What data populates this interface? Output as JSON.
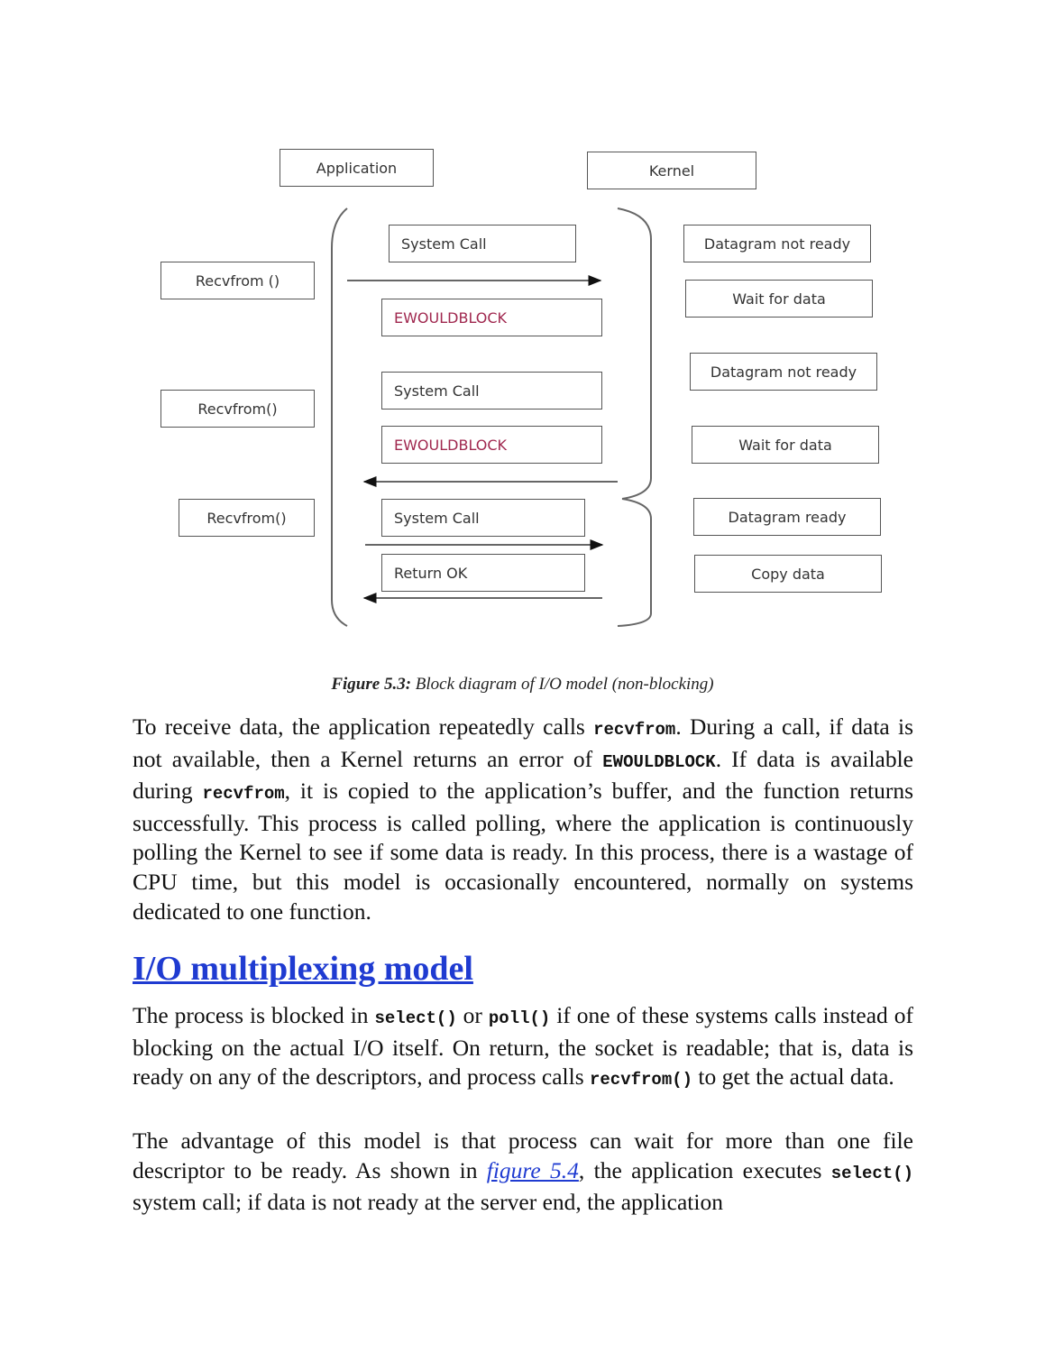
{
  "diagram": {
    "headers": {
      "application": "Application",
      "kernel": "Kernel"
    },
    "app_calls": [
      "Recvfrom ()",
      "Recvfrom()",
      "Recvfrom()"
    ],
    "middle_boxes": [
      "System Call",
      "EWOULDBLOCK",
      "System Call",
      "EWOULDBLOCK",
      "System Call",
      "Return OK"
    ],
    "kernel_boxes": [
      "Datagram not ready",
      "Wait for data",
      "Datagram not ready",
      "Wait for data",
      "Datagram ready",
      "Copy data"
    ],
    "colors": {
      "error_text": "#a0284f",
      "border": "#555555"
    }
  },
  "caption": {
    "label": "Figure 5.3:",
    "text": " Block diagram of I/O model (non-blocking)"
  },
  "para1": {
    "t1": "To receive data, the application repeatedly calls ",
    "c1": "recvfrom",
    "t2": ". During a call, if data is not available, then a Kernel returns an error of ",
    "c2": "EWOULDBLOCK",
    "t3": ". If data is available during ",
    "c3": "recvfrom",
    "t4": ", it is copied to the application’s buffer, and the function returns successfully. This process is called polling, where the application is continuously polling the Kernel to see if some data is ready. In this process, there is a wastage of CPU time, but this model is occasionally encountered, normally on systems dedicated to one function."
  },
  "section": {
    "heading": "I/O multiplexing model",
    "color": "#1f3bd1"
  },
  "para2": {
    "t1": "The process is blocked in ",
    "c1": "select()",
    "t2": " or ",
    "c2": "poll()",
    "t3": " if one of these systems calls instead of blocking on the actual I/O itself. On return, the socket is readable; that is, data is ready on any of the descriptors, and process calls ",
    "c3": "recvfrom()",
    "t4": " to get the actual data."
  },
  "para3": {
    "t1": "The advantage of this model is that process can wait for more than one file descriptor to be ready. As shown in ",
    "link": "figure 5.4",
    "t2": ", the application executes ",
    "c1": "select()",
    "t3": " system call; if data is not ready at the server end, the application"
  }
}
